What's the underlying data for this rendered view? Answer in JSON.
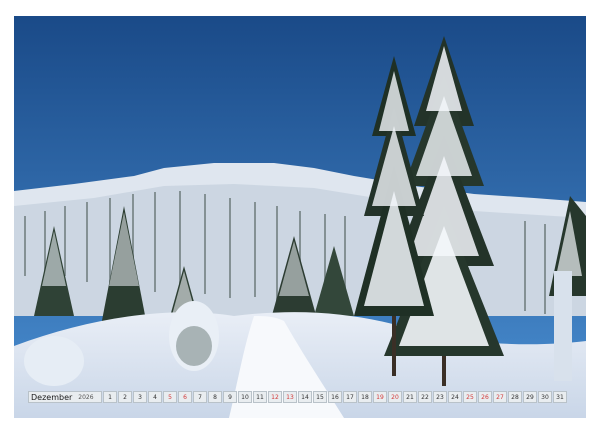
{
  "calendar": {
    "month": "Dezember",
    "year": "2026",
    "days": [
      {
        "n": "1",
        "type": "weekday"
      },
      {
        "n": "2",
        "type": "weekday"
      },
      {
        "n": "3",
        "type": "weekday"
      },
      {
        "n": "4",
        "type": "weekday"
      },
      {
        "n": "5",
        "type": "weekend"
      },
      {
        "n": "6",
        "type": "weekend"
      },
      {
        "n": "7",
        "type": "weekday"
      },
      {
        "n": "8",
        "type": "weekday"
      },
      {
        "n": "9",
        "type": "weekday"
      },
      {
        "n": "10",
        "type": "weekday"
      },
      {
        "n": "11",
        "type": "weekday"
      },
      {
        "n": "12",
        "type": "weekend"
      },
      {
        "n": "13",
        "type": "weekend"
      },
      {
        "n": "14",
        "type": "weekday"
      },
      {
        "n": "15",
        "type": "weekday"
      },
      {
        "n": "16",
        "type": "weekday"
      },
      {
        "n": "17",
        "type": "weekday"
      },
      {
        "n": "18",
        "type": "weekday"
      },
      {
        "n": "19",
        "type": "weekend"
      },
      {
        "n": "20",
        "type": "weekend"
      },
      {
        "n": "21",
        "type": "weekday"
      },
      {
        "n": "22",
        "type": "weekday"
      },
      {
        "n": "23",
        "type": "weekday"
      },
      {
        "n": "24",
        "type": "weekday"
      },
      {
        "n": "25",
        "type": "holiday"
      },
      {
        "n": "26",
        "type": "weekend"
      },
      {
        "n": "27",
        "type": "weekend"
      },
      {
        "n": "28",
        "type": "weekday"
      },
      {
        "n": "29",
        "type": "weekday"
      },
      {
        "n": "30",
        "type": "weekday"
      },
      {
        "n": "31",
        "type": "weekday"
      }
    ]
  },
  "colors": {
    "sky_top": "#1b4f8c",
    "sky_bottom": "#4d8fd0",
    "snow": "#f4f7fb",
    "snow_shadow": "#b9c9de",
    "forest_dark": "#2b3a2e",
    "holiday_red": "#d23a3a"
  }
}
